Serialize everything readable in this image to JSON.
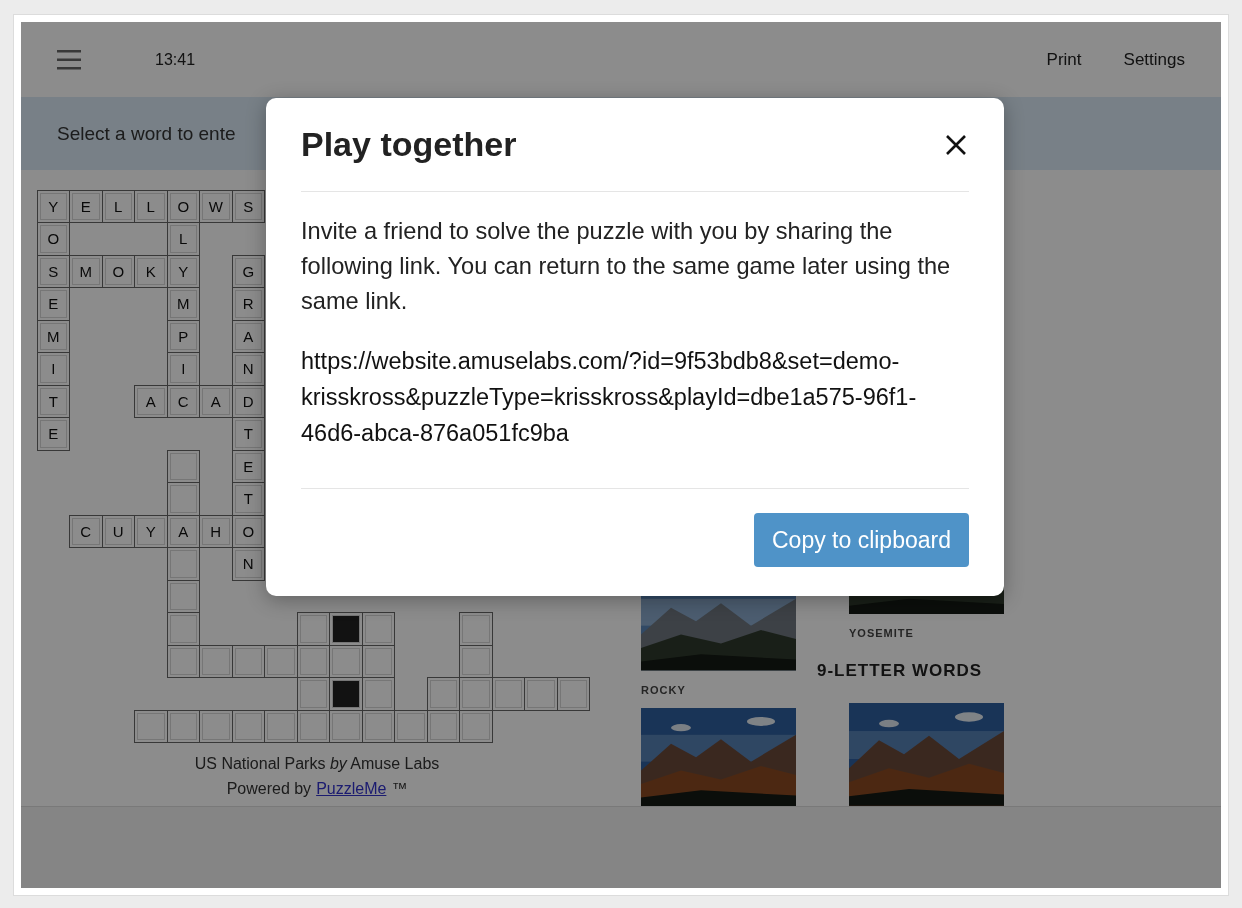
{
  "background_page": {
    "header": {
      "time": "13:41",
      "items": [
        {
          "label": "Print"
        },
        {
          "label": "Settings"
        }
      ]
    },
    "hint": "Select a word to ente",
    "crossword": {
      "rows": [
        [
          {
            "kind": "letter",
            "text": "Y"
          },
          {
            "kind": "letter",
            "text": "E"
          },
          {
            "kind": "letter",
            "text": "L"
          },
          {
            "kind": "letter",
            "text": "L"
          },
          {
            "kind": "letter",
            "text": "O"
          },
          {
            "kind": "letter",
            "text": "W"
          },
          {
            "kind": "letter",
            "text": "S"
          }
        ],
        [
          {
            "kind": "letter",
            "text": "O"
          },
          null,
          null,
          null,
          {
            "kind": "letter",
            "text": "L"
          }
        ],
        [
          {
            "kind": "letter",
            "text": "S"
          },
          {
            "kind": "letter",
            "text": "M"
          },
          {
            "kind": "letter",
            "text": "O"
          },
          {
            "kind": "letter",
            "text": "K"
          },
          {
            "kind": "letter",
            "text": "Y"
          },
          null,
          {
            "kind": "letter",
            "text": "G"
          }
        ],
        [
          {
            "kind": "letter",
            "text": "E"
          },
          null,
          null,
          null,
          {
            "kind": "letter",
            "text": "M"
          },
          null,
          {
            "kind": "letter",
            "text": "R"
          }
        ],
        [
          {
            "kind": "letter",
            "text": "M"
          },
          null,
          null,
          null,
          {
            "kind": "letter",
            "text": "P"
          },
          null,
          {
            "kind": "letter",
            "text": "A"
          }
        ],
        [
          {
            "kind": "letter",
            "text": "I"
          },
          null,
          null,
          null,
          {
            "kind": "letter",
            "text": "I"
          },
          null,
          {
            "kind": "letter",
            "text": "N"
          }
        ],
        [
          {
            "kind": "letter",
            "text": "T"
          },
          null,
          null,
          {
            "kind": "letter",
            "text": "A"
          },
          {
            "kind": "letter",
            "text": "C"
          },
          {
            "kind": "letter",
            "text": "A"
          },
          {
            "kind": "letter",
            "text": "D"
          }
        ],
        [
          {
            "kind": "letter",
            "text": "E"
          },
          null,
          null,
          null,
          null,
          null,
          {
            "kind": "letter",
            "text": "T"
          }
        ],
        [
          null,
          null,
          null,
          null,
          {
            "kind": "blank"
          },
          null,
          {
            "kind": "letter",
            "text": "E"
          }
        ],
        [
          null,
          null,
          null,
          null,
          {
            "kind": "blank"
          },
          null,
          {
            "kind": "letter",
            "text": "T"
          }
        ],
        [
          null,
          {
            "kind": "letter",
            "text": "C"
          },
          {
            "kind": "letter",
            "text": "U"
          },
          {
            "kind": "letter",
            "text": "Y"
          },
          {
            "kind": "letter",
            "text": "A"
          },
          {
            "kind": "letter",
            "text": "H"
          },
          {
            "kind": "letter",
            "text": "O"
          }
        ],
        [
          null,
          null,
          null,
          null,
          {
            "kind": "blank"
          },
          null,
          {
            "kind": "letter",
            "text": "N"
          }
        ],
        [
          null,
          null,
          null,
          null,
          {
            "kind": "blank"
          }
        ],
        [
          null,
          null,
          null,
          null,
          {
            "kind": "blank"
          },
          null,
          null,
          null,
          {
            "kind": "blank"
          },
          {
            "kind": "block"
          },
          {
            "kind": "blank"
          },
          null,
          null,
          {
            "kind": "blank"
          }
        ],
        [
          null,
          null,
          null,
          null,
          {
            "kind": "blank"
          },
          {
            "kind": "blank"
          },
          {
            "kind": "blank"
          },
          {
            "kind": "blank"
          },
          {
            "kind": "blank"
          },
          {
            "kind": "blank"
          },
          {
            "kind": "blank"
          },
          null,
          null,
          {
            "kind": "blank"
          }
        ],
        [
          null,
          null,
          null,
          null,
          null,
          null,
          null,
          null,
          {
            "kind": "blank"
          },
          {
            "kind": "block"
          },
          {
            "kind": "blank"
          },
          null,
          {
            "kind": "blank"
          },
          {
            "kind": "blank"
          },
          {
            "kind": "blank"
          },
          {
            "kind": "blank"
          },
          {
            "kind": "blank"
          }
        ],
        [
          null,
          null,
          null,
          {
            "kind": "blank"
          },
          {
            "kind": "blank"
          },
          {
            "kind": "blank"
          },
          {
            "kind": "blank"
          },
          {
            "kind": "blank"
          },
          {
            "kind": "blank"
          },
          {
            "kind": "blank"
          },
          {
            "kind": "blank"
          },
          {
            "kind": "blank"
          },
          {
            "kind": "blank"
          },
          {
            "kind": "blank"
          }
        ]
      ]
    },
    "caption": {
      "title": "US National Parks *by* Amuse Labs",
      "powered_prefix": "Powered by",
      "link": "PuzzleMe",
      "suffix": "™"
    },
    "gallery": [
      [
        {
          "kind": "spacer"
        },
        {
          "kind": "picture"
        },
        {
          "kind": "label",
          "text": "ROCKY"
        },
        {
          "kind": "picture"
        }
      ],
      [
        {
          "kind": "picture"
        },
        {
          "kind": "label",
          "text": "YOSEMITE"
        },
        {
          "kind": "heading",
          "text": "9-LETTER WORDS"
        },
        {
          "kind": "picture"
        }
      ]
    ]
  },
  "dialog": {
    "title": "Play together",
    "message": "Invite a friend to solve the puzzle with you by sharing the following link. You can return to the same game later using the same link.",
    "link": "https://website.amuselabs.com/?id=9f53bdb8&set=demo-krisskross&puzzleType=krisskross&playId=dbe1a575-96f1-46d6-abca-876a051fc9ba",
    "button": "Copy to clipboard"
  }
}
